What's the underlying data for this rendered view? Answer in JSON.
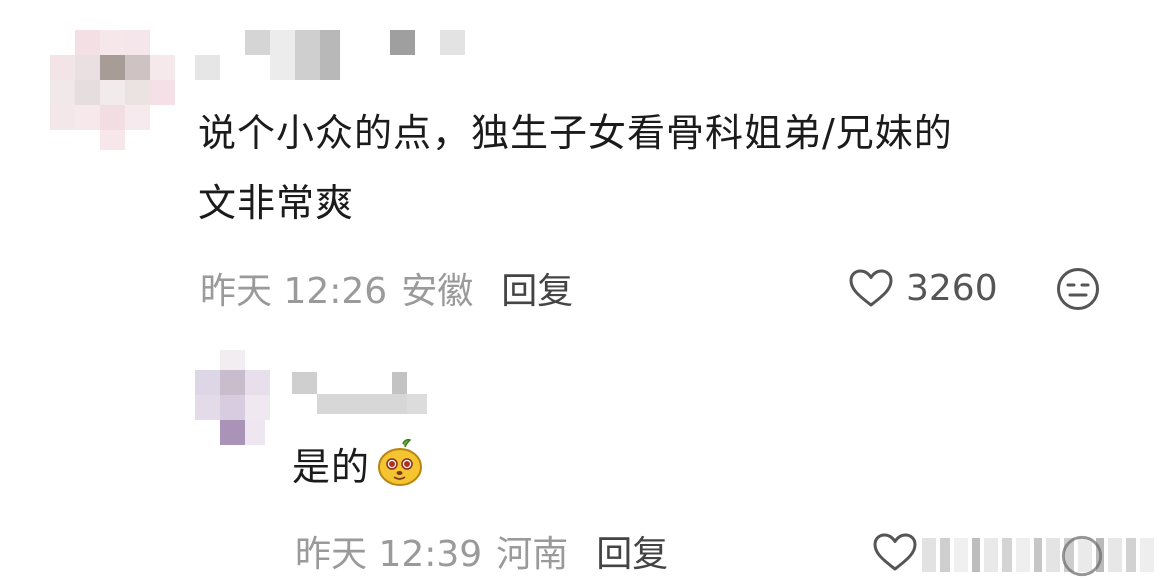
{
  "comments": [
    {
      "text_line1": "说个小众的点，独生子女看骨科姐弟/兄妹的",
      "text_line2": "文非常爽",
      "time": "昨天 12:26",
      "location": "安徽",
      "reply_label": "回复",
      "like_count": "3260",
      "username_blurred": true
    }
  ],
  "replies": [
    {
      "text": "是的",
      "emoji": "bean-emoji",
      "time": "昨天 12:39",
      "location": "河南",
      "reply_label": "回复",
      "username_blurred": true
    }
  ],
  "icons": {
    "like": "heart-outline-icon",
    "dislike": "neutral-face-icon"
  },
  "colors": {
    "text": "#1b1b1b",
    "meta": "#9a9a9a",
    "reply_label": "#444444",
    "emoji_fill": "#f5c531"
  }
}
